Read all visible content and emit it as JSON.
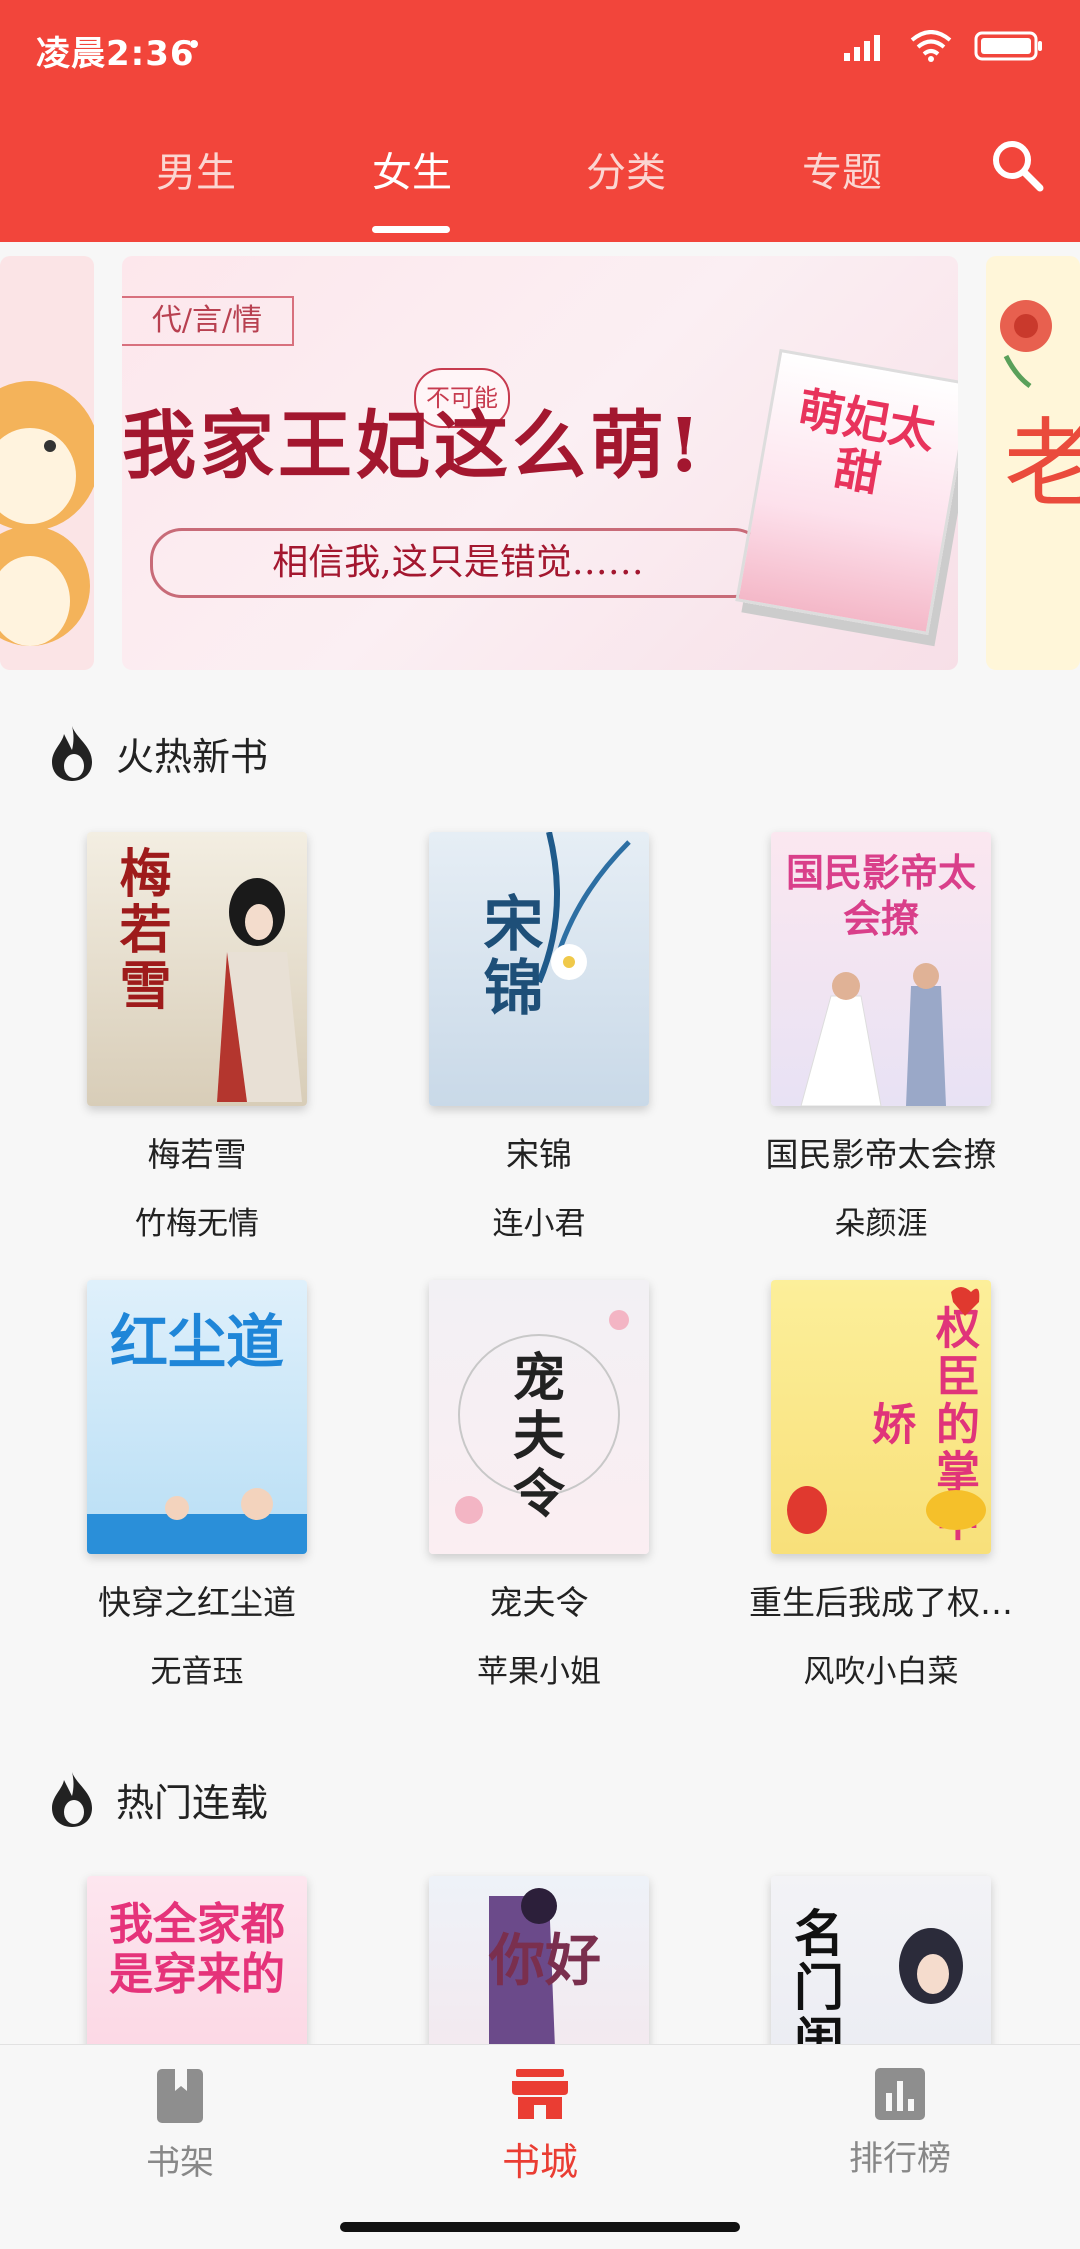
{
  "status_bar": {
    "time": "凌晨2:36"
  },
  "tabs": [
    {
      "label": "男生",
      "active": false
    },
    {
      "label": "女生",
      "active": true
    },
    {
      "label": "分类",
      "active": false
    },
    {
      "label": "专题",
      "active": false
    }
  ],
  "banner": {
    "tag": "代/言/情",
    "title": "我家王妃这么萌!",
    "bubble": "不可能",
    "subtitle": "相信我,这只是错觉……",
    "book_cover_title": "萌妃太甜",
    "right_peek_char": "老"
  },
  "sections": [
    {
      "title": "火热新书",
      "books": [
        {
          "title": "梅若雪",
          "author": "竹梅无情",
          "cover_text": "梅若雪"
        },
        {
          "title": "宋锦",
          "author": "连小君",
          "cover_text": "宋锦"
        },
        {
          "title": "国民影帝太会撩",
          "author": "朵颜涯",
          "cover_text": "国民影帝太会撩"
        },
        {
          "title": "快穿之红尘道",
          "author": "无音珏",
          "cover_text": "红尘道"
        },
        {
          "title": "宠夫令",
          "author": "苹果小姐",
          "cover_text": "宠夫令"
        },
        {
          "title": "重生后我成了权…",
          "author": "风吹小白菜",
          "cover_text": "权臣的掌中娇"
        }
      ]
    },
    {
      "title": "热门连载",
      "books": [
        {
          "cover_text": "我全家都是穿来的"
        },
        {
          "cover_text": "你好"
        },
        {
          "cover_text": "名门闺秀"
        }
      ]
    }
  ],
  "bottom_nav": [
    {
      "label": "书架",
      "icon": "bookshelf-icon",
      "active": false
    },
    {
      "label": "书城",
      "icon": "store-icon",
      "active": true
    },
    {
      "label": "排行榜",
      "icon": "ranking-icon",
      "active": false
    }
  ],
  "colors": {
    "accent": "#f2453b",
    "active_nav": "#ea3d33"
  }
}
